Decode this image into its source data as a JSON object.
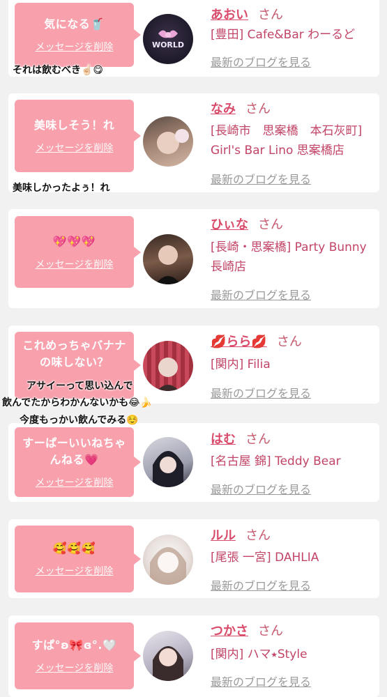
{
  "delete_label": "メッセージを削除",
  "blog_label": "最新のブログを見る",
  "san_label": "さん",
  "cards": [
    {
      "message": "気になる🥤",
      "name": "あおい",
      "shop": "[豊田] Cafe&Bar わーるど",
      "avatar_text": "Cafe&Bar WORLD"
    },
    {
      "message": "美味しそう！れ",
      "name": "なみ",
      "shop": "[長崎市　思案橋　本石灰町] Girl's Bar Lino 思案橋店"
    },
    {
      "message": "💖💖💖",
      "name": "ひぃな",
      "shop": "[長崎・思案橋] Party Bunny 長崎店"
    },
    {
      "message": "これめっちゃバナナの味しない？",
      "name": "💋らら💋",
      "shop": "[関内] Filia"
    },
    {
      "message": "すーぱーいいねちゃんねる💗",
      "name": "はむ",
      "shop": "[名古屋 錦] Teddy Bear"
    },
    {
      "message": "🥰🥰🥰",
      "name": "ルル",
      "shop": "[尾張 一宮] DAHLIA"
    },
    {
      "message": "すぱ°ʚ🎀ɞ°.🤍",
      "name": "つかさ",
      "shop": "[関内] ハマ⭑Style"
    }
  ],
  "captions": {
    "c1": "それは飲むべき☝🏻😋",
    "c2": "美味しかったよぅ！れ",
    "c3a": "アサイーって思い込んで",
    "c3b": "飲んでたからわかんないかも😂🍌",
    "c3c": "今度もっかい飲んでみる☺️"
  },
  "colors": {
    "bubble": "#f8a1ad",
    "name": "#d94b6b",
    "shop": "#c24466"
  }
}
